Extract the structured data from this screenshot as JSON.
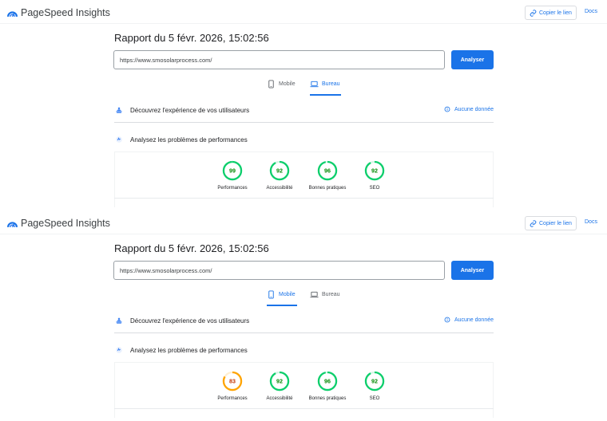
{
  "panels": [
    {
      "header": {
        "app_title": "PageSpeed Insights",
        "copy_link_label": "Copier le lien",
        "docs_label": "Docs"
      },
      "report_title": "Rapport du 5 févr. 2026, 15:02:56",
      "url_value": "https://www.smosolarprocess.com/",
      "analyze_label": "Analyser",
      "tabs": {
        "mobile": "Mobile",
        "desktop": "Bureau",
        "active": "desktop"
      },
      "experience_label": "Découvrez l'expérience de vos utilisateurs",
      "no_data_label": "Aucune donnée",
      "analyze_section_label": "Analysez les problèmes de performances",
      "scores": [
        {
          "label": "Performances",
          "value": 99,
          "color": "#0cce6b",
          "text_color": "#008800"
        },
        {
          "label": "Accessibilité",
          "value": 92,
          "color": "#0cce6b",
          "text_color": "#008800"
        },
        {
          "label": "Bonnes pratiques",
          "value": 96,
          "color": "#0cce6b",
          "text_color": "#008800"
        },
        {
          "label": "SEO",
          "value": 92,
          "color": "#0cce6b",
          "text_color": "#008800"
        }
      ]
    },
    {
      "header": {
        "app_title": "PageSpeed Insights",
        "copy_link_label": "Copier le lien",
        "docs_label": "Docs"
      },
      "report_title": "Rapport du 5 févr. 2026, 15:02:56",
      "url_value": "https://www.smosolarprocess.com/",
      "analyze_label": "Analyser",
      "tabs": {
        "mobile": "Mobile",
        "desktop": "Bureau",
        "active": "mobile"
      },
      "experience_label": "Découvrez l'expérience de vos utilisateurs",
      "no_data_label": "Aucune donnée",
      "analyze_section_label": "Analysez les problèmes de performances",
      "scores": [
        {
          "label": "Performances",
          "value": 83,
          "color": "#ffa400",
          "text_color": "#c33300"
        },
        {
          "label": "Accessibilité",
          "value": 92,
          "color": "#0cce6b",
          "text_color": "#008800"
        },
        {
          "label": "Bonnes pratiques",
          "value": 96,
          "color": "#0cce6b",
          "text_color": "#008800"
        },
        {
          "label": "SEO",
          "value": 92,
          "color": "#0cce6b",
          "text_color": "#008800"
        }
      ]
    }
  ],
  "colors": {
    "accent": "#1a73e8",
    "pass": "#0cce6b",
    "average": "#ffa400"
  }
}
